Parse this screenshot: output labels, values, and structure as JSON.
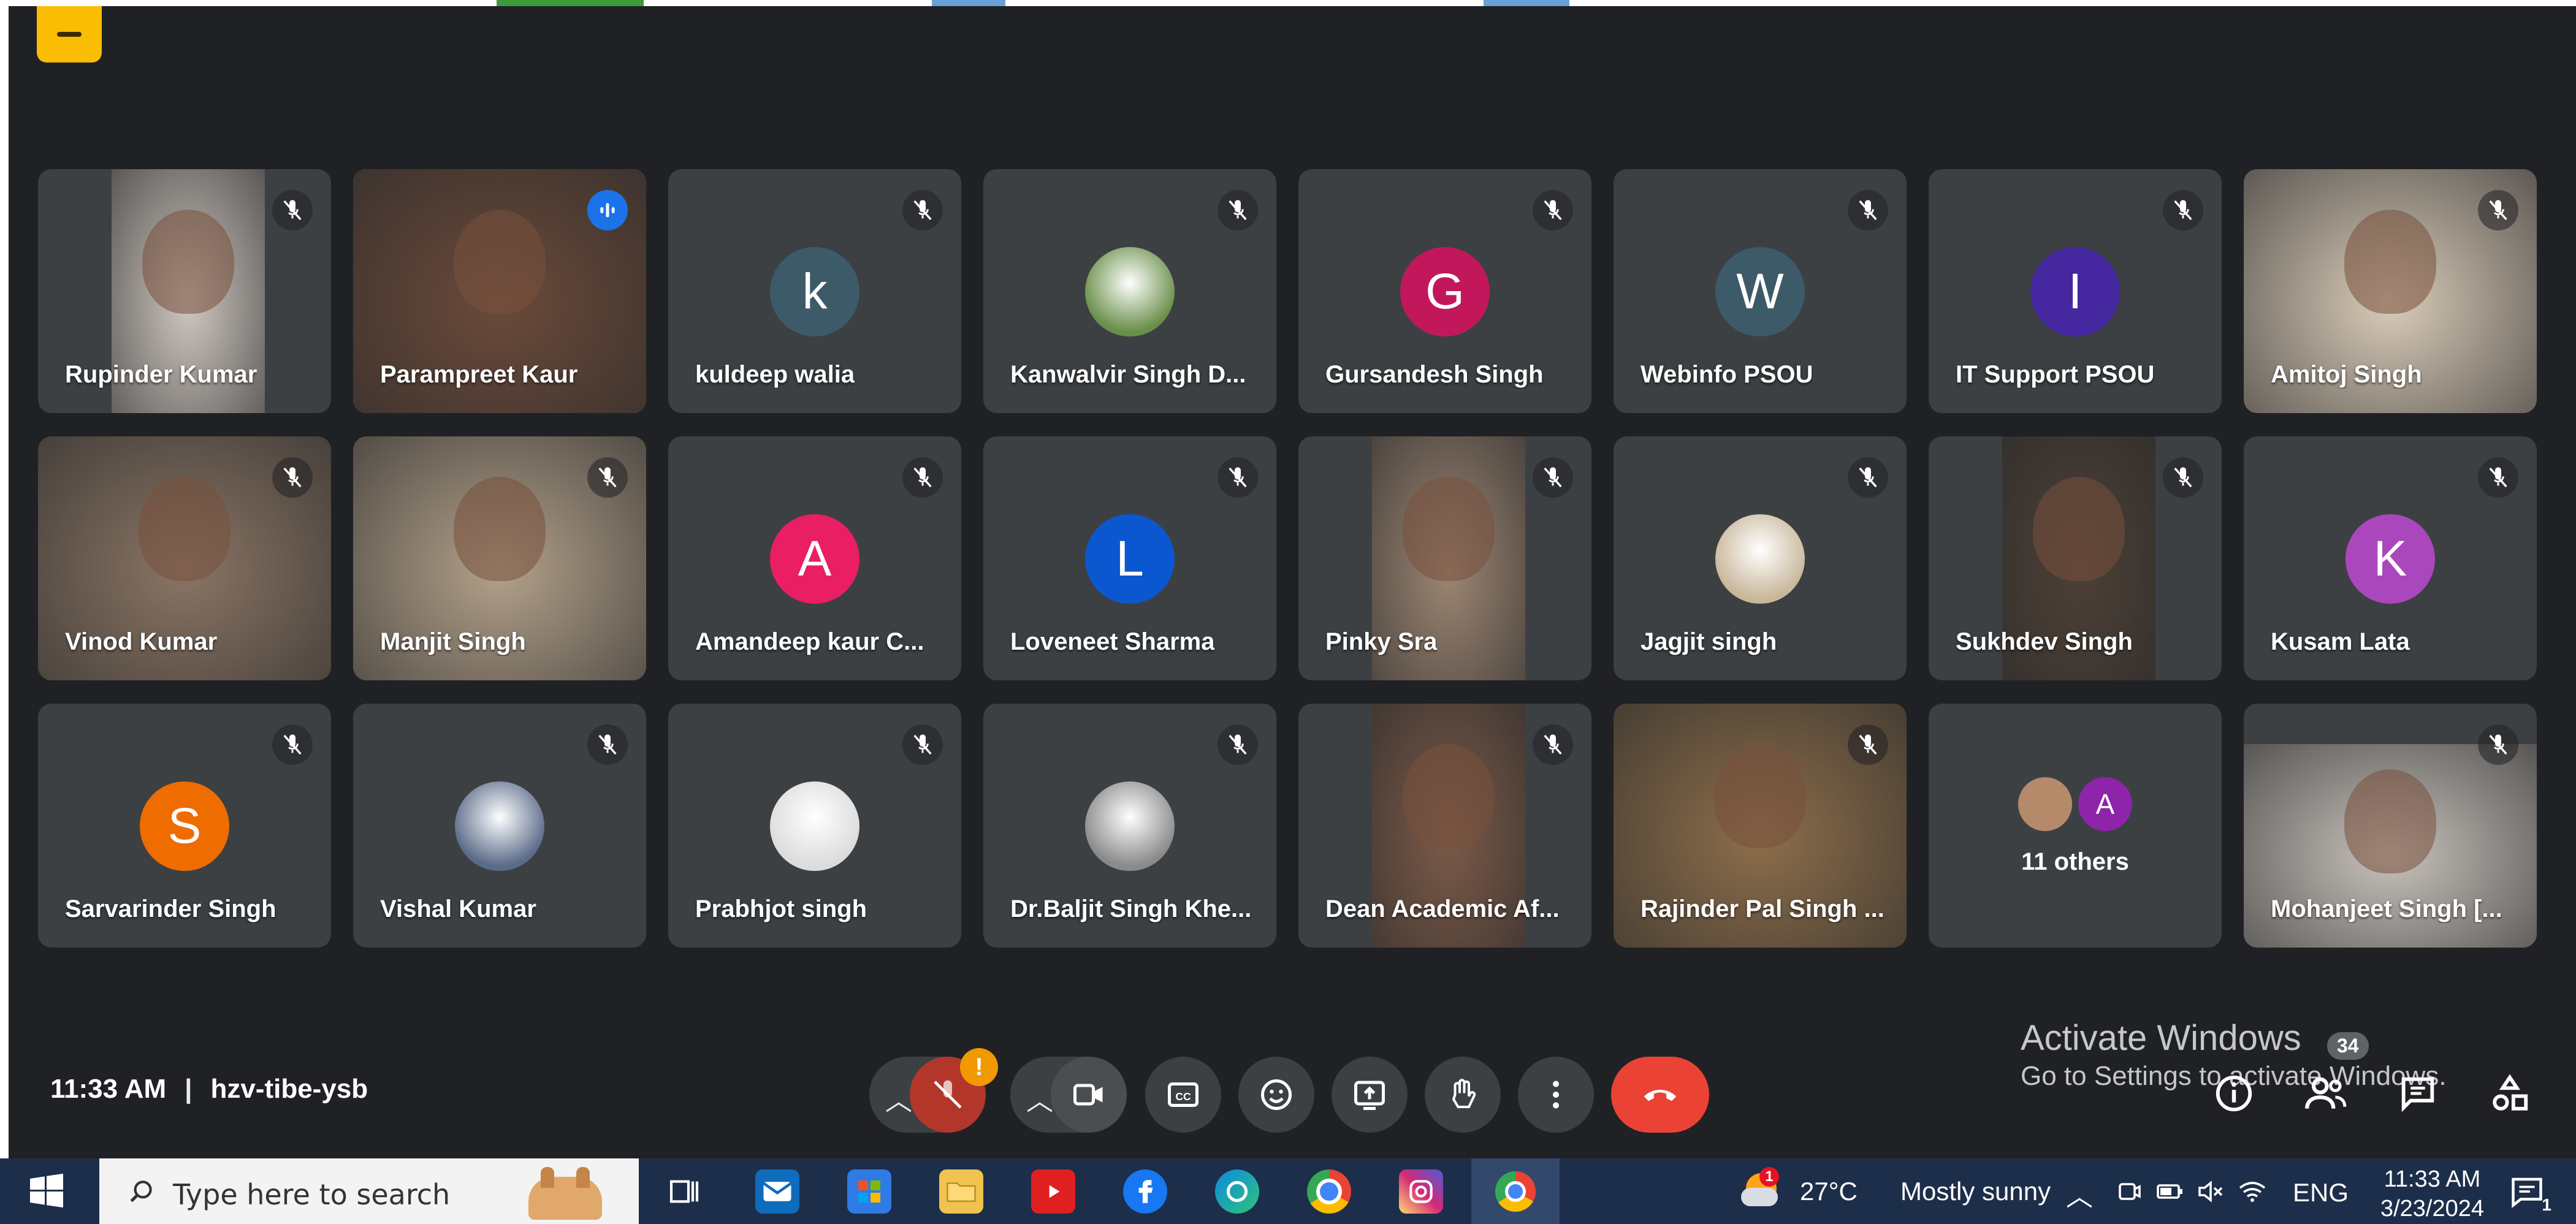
{
  "meeting": {
    "time": "11:33 AM",
    "code": "hzv-tibe-ysb"
  },
  "participants": [
    {
      "name": "Rupinder Kumar",
      "type": "video",
      "video_color": "#cfc7c0"
    },
    {
      "name": "Parampreet Kaur",
      "type": "video",
      "video_color": "#6b4a3a",
      "active": true
    },
    {
      "name": "kuldeep walia",
      "type": "avatar",
      "initial": "k",
      "color": "#3d5a68"
    },
    {
      "name": "Kanwalvir Singh D...",
      "type": "photo",
      "color": "#6a8f4a"
    },
    {
      "name": "Gursandesh Singh",
      "type": "avatar",
      "initial": "G",
      "color": "#c2185b"
    },
    {
      "name": "Webinfo PSOU",
      "type": "avatar",
      "initial": "W",
      "color": "#3d5a68"
    },
    {
      "name": "IT Support PSOU",
      "type": "avatar",
      "initial": "I",
      "color": "#4527a0"
    },
    {
      "name": "Amitoj Singh",
      "type": "video",
      "video_color": "#d9cbb8"
    },
    {
      "name": "Vinod Kumar",
      "type": "video",
      "video_color": "#8a7564"
    },
    {
      "name": "Manjit Singh",
      "type": "video",
      "video_color": "#b3a18a"
    },
    {
      "name": "Amandeep kaur C...",
      "type": "avatar",
      "initial": "A",
      "color": "#e91e63"
    },
    {
      "name": "Loveneet Sharma",
      "type": "avatar",
      "initial": "L",
      "color": "#0b57d0"
    },
    {
      "name": "Pinky Sra",
      "type": "video",
      "video_color": "#9d8673"
    },
    {
      "name": "Jagjit singh",
      "type": "photo",
      "color": "#c9b79a"
    },
    {
      "name": "Sukhdev Singh",
      "type": "video",
      "video_color": "#4d4036"
    },
    {
      "name": "Kusam Lata",
      "type": "avatar",
      "initial": "K",
      "color": "#ab47bc"
    },
    {
      "name": "Sarvarinder Singh",
      "type": "avatar",
      "initial": "S",
      "color": "#ef6c00"
    },
    {
      "name": "Vishal Kumar",
      "type": "photo",
      "color": "#5a6b88"
    },
    {
      "name": "Prabhjot singh",
      "type": "photo",
      "color": "#dcdcdc"
    },
    {
      "name": "Dr.Baljit Singh Khe...",
      "type": "photo",
      "color": "#8a8a8a"
    },
    {
      "name": "Dean Academic Af...",
      "type": "video",
      "video_color": "#7b5a48"
    },
    {
      "name": "Rajinder Pal Singh ...",
      "type": "video",
      "video_color": "#8d6e4a"
    },
    {
      "name": "11 others",
      "type": "others",
      "initial": "A",
      "color": "#8e24aa"
    },
    {
      "name": "Mohanjeet Singh [...",
      "type": "video",
      "video_color": "#c8c2bc"
    }
  ],
  "controls": {
    "mic_badge": "!",
    "people_count": "34",
    "chat_count": ""
  },
  "watermark": {
    "line1": "Activate Windows",
    "line2": "Go to Settings to activate Windows."
  },
  "taskbar": {
    "search_placeholder": "Type here to search",
    "weather_temp": "27°C",
    "weather_text": "Mostly sunny",
    "language": "ENG",
    "time": "11:33 AM",
    "date": "3/23/2024",
    "notification_count": "1",
    "weather_badge": "1"
  },
  "colors": {
    "background": "#202124",
    "tile": "#3c4043",
    "accent": "#8ab4f8",
    "leave_red": "#ea4335",
    "taskbar": "#1c2e4a"
  }
}
